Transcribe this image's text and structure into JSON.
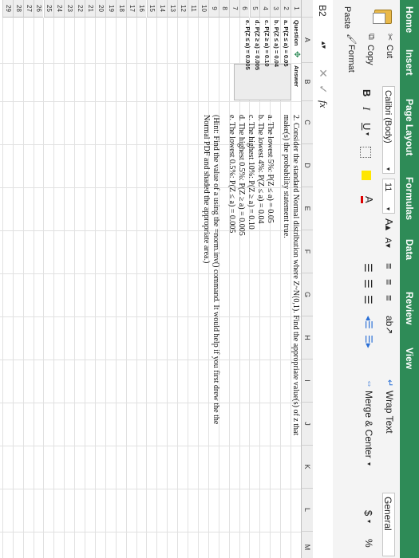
{
  "tabs": [
    "Home",
    "Insert",
    "Page Layout",
    "Formulas",
    "Data",
    "Review",
    "View"
  ],
  "ribbon": {
    "cut": "Cut",
    "copy": "Copy",
    "paste": "Paste",
    "format": "Format",
    "font_name": "Calibri (Body)",
    "font_size": "11",
    "wrap_text": "Wrap Text",
    "merge_center": "Merge & Center",
    "number_format": "General",
    "currency": "$"
  },
  "name_box": "B2",
  "fx": "fx",
  "columns": [
    "A",
    "B",
    "C",
    "D",
    "E",
    "F",
    "G",
    "H",
    "I",
    "J",
    "K",
    "L",
    "M"
  ],
  "rows": [
    "1",
    "2",
    "3",
    "4",
    "5",
    "6",
    "7",
    "8",
    "9",
    "10",
    "11",
    "12",
    "13",
    "14",
    "15",
    "16",
    "17",
    "18",
    "19",
    "20",
    "21",
    "22",
    "23",
    "24",
    "25",
    "26",
    "27",
    "28",
    "29"
  ],
  "cells": {
    "a1": "Question",
    "b1": "Answer",
    "a2": "a. P(Z ≤ a) = 0.05",
    "a3": "b. P(Z ≤ a) = 0.04",
    "a4": "c. P(Z ≥ a) = 0.10",
    "a5": "d. P(Z ≥ a) = 0.005",
    "a6": "e. P(Z ≤ a) = 0.005"
  },
  "question": {
    "line1": "2.  Consider the standard Normal distribution where Z~N(0,1).  Find the appropriate value(s) of z that",
    "line2": "make(s) the probability statement true.",
    "items": [
      "a.  The lowest 5%:  P(Z ≤ a) = 0.05",
      "b.  The lowest 4%:  P(Z ≤ a) = 0.04",
      "c.  The highest 10%:  P(Z ≥ a) = 0.10",
      "d.  The highest 0.5%:  P(Z ≥ a) = 0.005",
      "e.  The lowest 0.5%:  P(Z ≤ a) = 0.005"
    ],
    "hint1": "(Hint:  Find the value of a using the =norm.inv() command.  It would help if you first drew the the",
    "hint2": "Normal PDF and shaded the appropriate area.)"
  }
}
